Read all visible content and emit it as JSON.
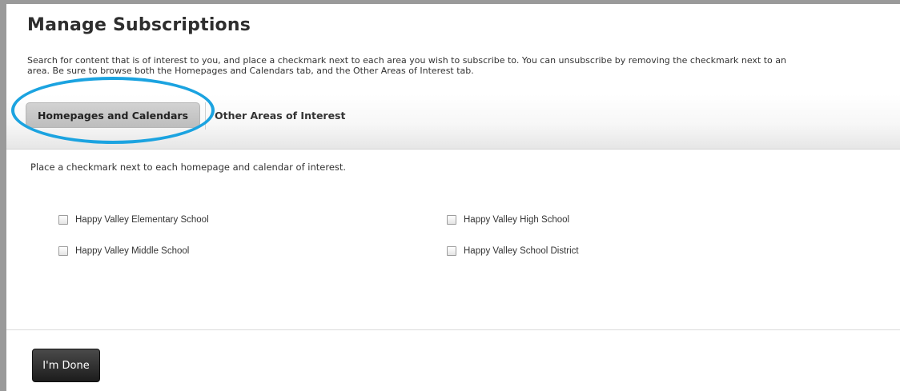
{
  "page": {
    "title": "Manage Subscriptions",
    "intro_line1": "Search for content that is of interest to you, and place a checkmark next to each area you wish to subscribe to. You can unsubscribe by removing the checkmark next to an",
    "intro_line2": "area. Be sure to browse both the Homepages and Calendars tab, and the Other Areas of Interest tab."
  },
  "tabs": [
    {
      "label": "Homepages and Calendars",
      "active": true
    },
    {
      "label": "Other Areas of Interest",
      "active": false
    }
  ],
  "panel": {
    "instruction": "Place a checkmark next to each homepage and calendar of interest.",
    "options": [
      {
        "label": "Happy Valley Elementary School",
        "checked": false
      },
      {
        "label": "Happy Valley High School",
        "checked": false
      },
      {
        "label": "Happy Valley Middle School",
        "checked": false
      },
      {
        "label": "Happy Valley School District",
        "checked": false
      }
    ]
  },
  "footer": {
    "done_label": "I'm Done"
  },
  "colors": {
    "highlight": "#1ba3e0",
    "button_bg": "#2a2a2a"
  }
}
